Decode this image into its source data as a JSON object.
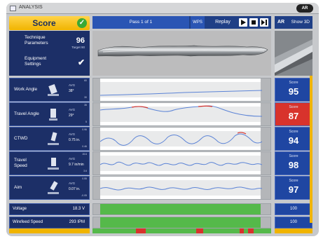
{
  "window": {
    "title": "ANALYSIS",
    "brand": "AR"
  },
  "score_panel": {
    "label": "Score",
    "check_icon": "check-circle-icon"
  },
  "info": {
    "technique_label": "Technique Parameters",
    "technique_value": "96",
    "technique_target": "Target 90",
    "equipment_label": "Equipment Settings",
    "equipment_value": "✔"
  },
  "toolbar": {
    "pass_label": "Pass 1 of 1",
    "wps_label": "WPS",
    "replay_label": "Replay",
    "ar_label": "AR",
    "show3d_label": "Show 3D"
  },
  "parameters": [
    {
      "name": "Work Angle",
      "avg_label": "AVG",
      "avg_value": "38°",
      "ticks": [
        "60",
        "",
        "30"
      ],
      "score_label": "Score",
      "score": "95",
      "status": "good"
    },
    {
      "name": "Travel Angle",
      "avg_label": "AVG",
      "avg_value": "29°",
      "ticks": [
        "35",
        "",
        "5"
      ],
      "score_label": "Score",
      "score": "87",
      "status": "bad"
    },
    {
      "name": "CTWD",
      "avg_label": "AVG",
      "avg_value": "0.75 in.",
      "ticks": [
        "0.96",
        "",
        "0.46"
      ],
      "score_label": "Score",
      "score": "94",
      "status": "good"
    },
    {
      "name": "Travel Speed",
      "avg_label": "AVG",
      "avg_value": "9.7 in/min",
      "ticks": [
        "15.6",
        "",
        "3.6"
      ],
      "score_label": "Score",
      "score": "98",
      "status": "good"
    },
    {
      "name": "Aim",
      "avg_label": "AVG",
      "avg_value": "0.07 in.",
      "ticks": [
        "0.55",
        "",
        "-0.05"
      ],
      "score_label": "Score",
      "score": "97",
      "status": "good"
    }
  ],
  "settings": [
    {
      "name": "Voltage",
      "value": "18.3 V",
      "score": "100"
    },
    {
      "name": "Wirefeed Speed",
      "value": "293 IPM",
      "score": "100"
    }
  ],
  "colors": {
    "navy": "#1c2f67",
    "blue": "#1f46a2",
    "red": "#d8332c",
    "green": "#55b94a",
    "yellow": "#f0b400"
  }
}
